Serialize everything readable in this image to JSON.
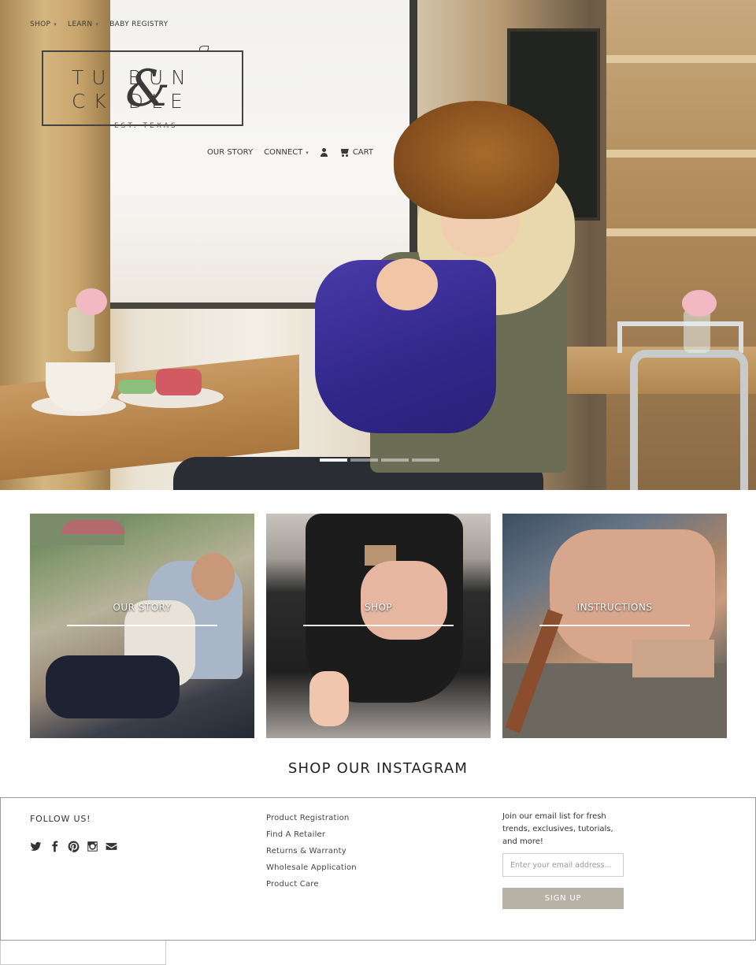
{
  "topnav": {
    "items": [
      {
        "label": "SHOP",
        "caret": "▾"
      },
      {
        "label": "LEARN",
        "caret": "▾"
      },
      {
        "label": "BABY REGISTRY"
      }
    ]
  },
  "logo": {
    "line1": "TU    BUN",
    "line2": "CK    DLE",
    "ampersand": "&",
    "est": "EST. TEXAS"
  },
  "mainnav": {
    "our_story": "OUR STORY",
    "connect": "CONNECT",
    "connect_caret": "▾",
    "account_icon": "user-icon",
    "cart_icon": "cart-icon",
    "cart": "CART"
  },
  "hero": {
    "slides": 4,
    "active_slide": 1
  },
  "tiles": [
    {
      "label": "OUR STORY"
    },
    {
      "label": "SHOP"
    },
    {
      "label": "INSTRUCTIONS"
    }
  ],
  "instagram": {
    "title": "SHOP OUR INSTAGRAM"
  },
  "footer": {
    "follow_title": "FOLLOW US!",
    "social_icons": [
      "twitter-icon",
      "facebook-icon",
      "pinterest-icon",
      "instagram-icon",
      "email-icon"
    ],
    "links": [
      "Product Registration",
      "Find A Retailer",
      "Returns & Warranty",
      "Wholesale Application",
      "Product Care"
    ],
    "newsletter_text": "Join our email list for fresh trends, exclusives, tutorials, and more!",
    "email_placeholder": "Enter your email address...",
    "signup_label": "SIGN UP"
  },
  "colors": {
    "signup_button": "#b7b2a5",
    "text": "#333333",
    "border": "#9a9a9a"
  }
}
